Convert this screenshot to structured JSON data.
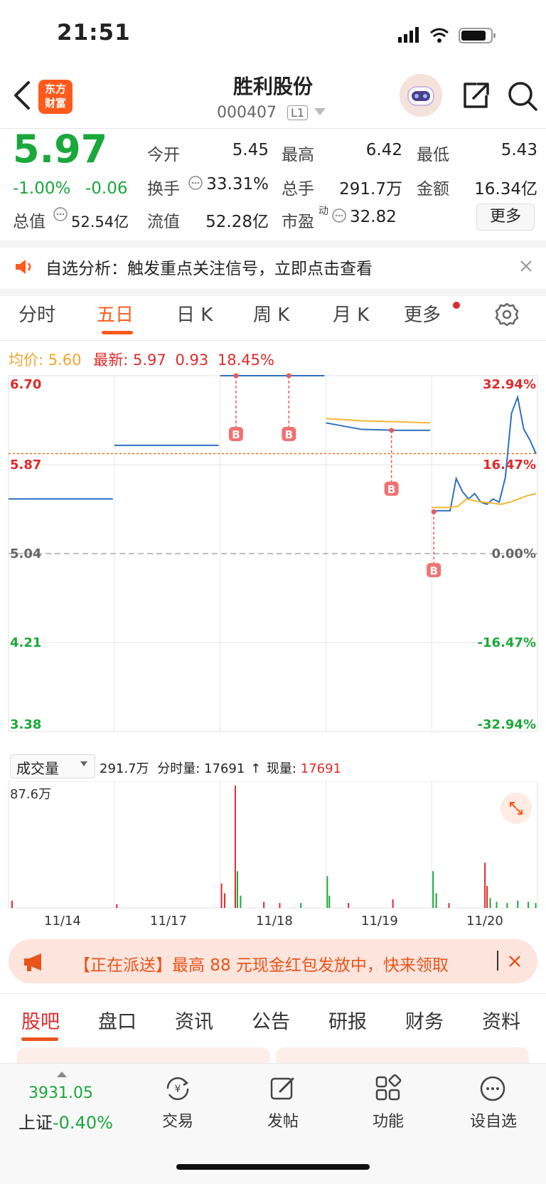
{
  "status_bar": {
    "time": "21:51"
  },
  "header": {
    "logo_text": [
      "东方",
      "财富"
    ],
    "title": "胜利股份",
    "code": "000407",
    "level_badge": "L1"
  },
  "quote": {
    "price": "5.97",
    "change_pct": "-1.00%",
    "change": "-0.06",
    "open_label": "今开",
    "open": "5.45",
    "high_label": "最高",
    "high": "6.42",
    "low_label": "最低",
    "low": "5.43",
    "turnover_label": "换手",
    "turnover": "33.31%",
    "volume_label": "总手",
    "volume": "291.7万",
    "amount_label": "金额",
    "amount": "16.34亿",
    "mcap_label": "总值",
    "mcap": "52.54亿",
    "float_label": "流值",
    "float_cap": "52.28亿",
    "pe_label": "市盈",
    "pe_sup": "动",
    "pe": "32.82",
    "more_label": "更多"
  },
  "notice": {
    "text": "自选分析：触发重点关注信号，立即点击查看"
  },
  "chart_tabs": [
    "分时",
    "五日",
    "日 K",
    "周 K",
    "月 K",
    "更多"
  ],
  "active_chart_tab": "五日",
  "summary": {
    "avg_label": "均价:",
    "avg": "5.60",
    "latest_label": "最新:",
    "latest": "5.97",
    "latest_change": "0.93",
    "latest_pct": "18.45%"
  },
  "chart_data": {
    "type": "line",
    "title": "",
    "y_left_ticks": [
      "6.70",
      "5.87",
      "5.04",
      "4.21",
      "3.38"
    ],
    "y_right_ticks": [
      "32.94%",
      "16.47%",
      "0.00%",
      "-16.47%",
      "-32.94%"
    ],
    "ylim": [
      3.38,
      6.7
    ],
    "prev_close": 5.04,
    "x_dates": [
      "11/14",
      "11/17",
      "11/18",
      "11/19",
      "11/20"
    ],
    "series": [
      {
        "name": "",
        "color": "#2f6fc0",
        "days": [
          [
            5.55,
            5.55
          ],
          [
            6.05,
            6.05
          ],
          [
            6.7,
            6.7
          ],
          [
            6.26,
            6.2,
            6.19,
            6.19
          ],
          [
            5.43,
            5.44,
            5.44,
            5.44,
            5.74,
            5.62,
            5.55,
            5.6,
            5.52,
            5.5,
            5.55,
            5.52,
            5.75,
            6.35,
            6.5,
            6.2,
            6.1,
            5.97
          ]
        ]
      },
      {
        "name": "",
        "color": "#f2b736",
        "days": [
          [],
          [],
          [],
          [
            6.3,
            6.28,
            6.27,
            6.26
          ],
          [
            5.47,
            5.47,
            5.47,
            5.48,
            5.55,
            5.53,
            5.52,
            5.51,
            5.5,
            5.52,
            5.55,
            5.58,
            5.6
          ]
        ]
      }
    ],
    "markers": [
      "B",
      "B",
      "B",
      "B"
    ],
    "volume": {
      "label": "成交量",
      "total": "291.7万",
      "period_label": "分时量:",
      "period_value": "17691",
      "current_label": "现量:",
      "current_value": "17691",
      "max_label": "87.6万"
    }
  },
  "promo": {
    "text": "【正在派送】最高 88 元现金红包发放中，快来领取"
  },
  "bottom_tabs": [
    "股吧",
    "盘口",
    "资讯",
    "公告",
    "研报",
    "财务",
    "资料"
  ],
  "bottom_nav": {
    "index_value": "3931.05",
    "index_name": "上证",
    "index_change": "-0.40%",
    "items": [
      "交易",
      "发帖",
      "功能",
      "设自选"
    ]
  }
}
